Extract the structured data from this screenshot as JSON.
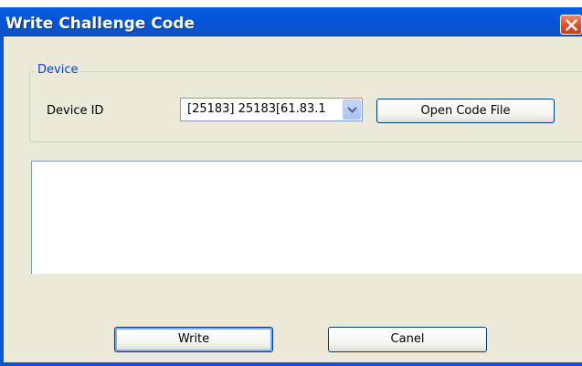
{
  "window": {
    "title": "Write Challenge Code"
  },
  "group": {
    "legend": "Device",
    "device_label": "Device ID",
    "device_select_value": "[25183] 25183[61.83.1",
    "open_button": "Open Code File"
  },
  "log": {
    "content": ""
  },
  "actions": {
    "write_button": "Write",
    "cancel_button": "Canel"
  },
  "colors": {
    "titlebar": "#0554d8",
    "dialog_bg": "#ece9d8",
    "legend_text": "#0046d5",
    "close_button": "#d9552d"
  }
}
